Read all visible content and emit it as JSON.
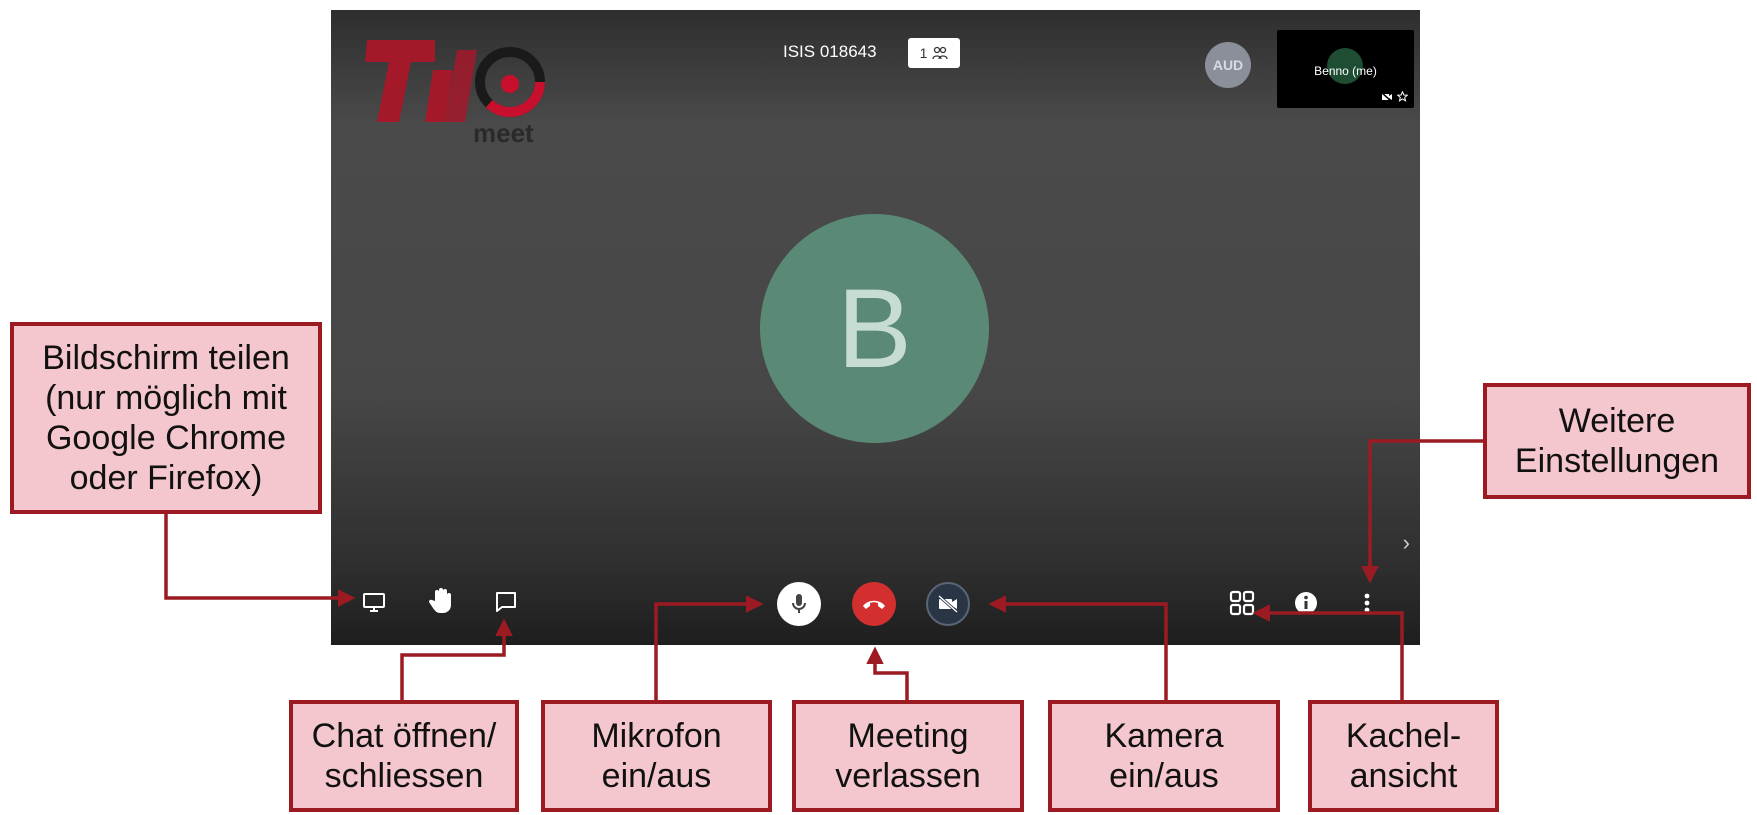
{
  "meeting": {
    "room_title": "ISIS 018643",
    "participant_count": "1",
    "aud_avatar_text": "AUD",
    "self_name": "Benno (me)",
    "main_avatar_letter": "B",
    "logo_text": "meet"
  },
  "toolbar": {
    "left": [
      "screen-share",
      "raise-hand",
      "chat"
    ],
    "center": [
      "microphone",
      "hang-up",
      "camera-off"
    ],
    "right": [
      "tile-view",
      "info",
      "more-options"
    ]
  },
  "callouts": {
    "screen_share": {
      "line1": "Bildschirm teilen",
      "line2": "(nur möglich mit",
      "line3": "Google Chrome",
      "line4": "oder Firefox)"
    },
    "more_settings": {
      "line1": "Weitere",
      "line2": "Einstellungen"
    },
    "chat": {
      "line1": "Chat öffnen/",
      "line2": "schliessen"
    },
    "microphone": {
      "line1": "Mikrofon",
      "line2": "ein/aus"
    },
    "leave": {
      "line1": "Meeting",
      "line2": "verlassen"
    },
    "camera": {
      "line1": "Kamera",
      "line2": "ein/aus"
    },
    "tile_view": {
      "line1": "Kachel-",
      "line2": "ansicht"
    }
  },
  "colors": {
    "callout_fill": "#f4c6cd",
    "callout_border": "#9c1b23",
    "hangup": "#d32f2f",
    "avatar": "#5a8a76"
  }
}
